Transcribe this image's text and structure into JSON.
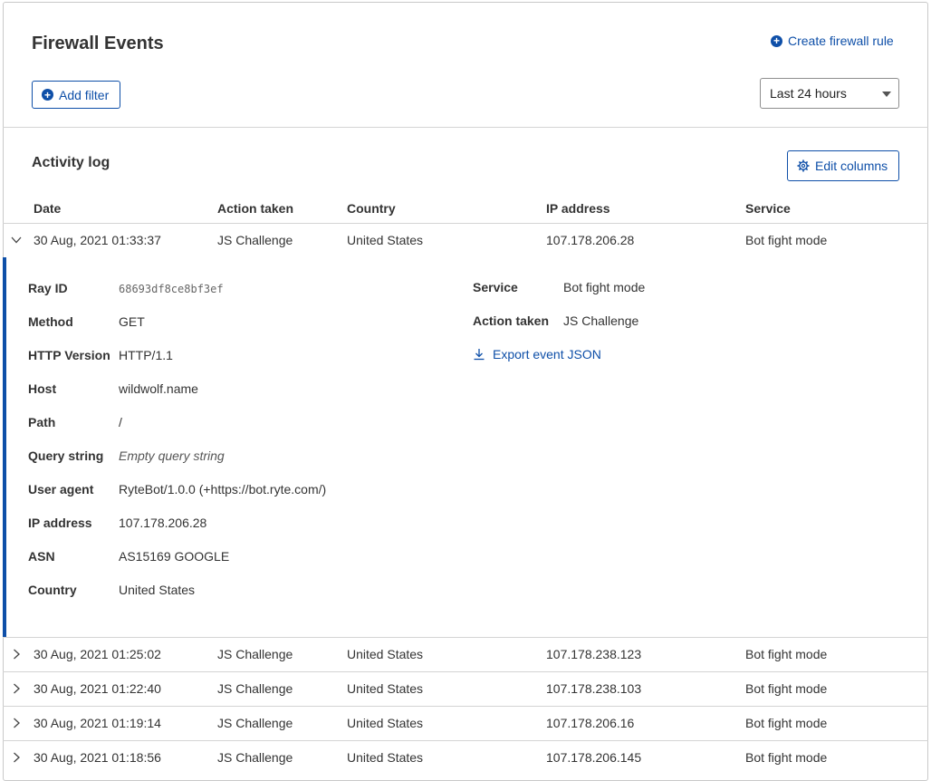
{
  "header": {
    "title": "Firewall Events",
    "create_rule_label": "Create firewall rule",
    "add_filter_label": "Add filter",
    "time_range": "Last 24 hours"
  },
  "activity": {
    "title": "Activity log",
    "edit_columns_label": "Edit columns",
    "columns": [
      "Date",
      "Action taken",
      "Country",
      "IP address",
      "Service"
    ],
    "expanded_row": {
      "date": "30 Aug, 2021 01:33:37",
      "action": "JS Challenge",
      "country": "United States",
      "ip": "107.178.206.28",
      "service": "Bot fight mode"
    },
    "details": {
      "left": [
        {
          "label": "Ray ID",
          "value": "68693df8ce8bf3ef"
        },
        {
          "label": "Method",
          "value": "GET"
        },
        {
          "label": "HTTP Version",
          "value": "HTTP/1.1"
        },
        {
          "label": "Host",
          "value": "wildwolf.name"
        },
        {
          "label": "Path",
          "value": "/"
        },
        {
          "label": "Query string",
          "value": "Empty query string"
        },
        {
          "label": "User agent",
          "value": "RyteBot/1.0.0 (+https://bot.ryte.com/)"
        },
        {
          "label": "IP address",
          "value": "107.178.206.28"
        },
        {
          "label": "ASN",
          "value": "AS15169 GOOGLE"
        },
        {
          "label": "Country",
          "value": "United States"
        }
      ],
      "right": [
        {
          "label": "Service",
          "value": "Bot fight mode"
        },
        {
          "label": "Action taken",
          "value": "JS Challenge"
        }
      ],
      "export_label": "Export event JSON"
    },
    "rows": [
      {
        "date": "30 Aug, 2021 01:25:02",
        "action": "JS Challenge",
        "country": "United States",
        "ip": "107.178.238.123",
        "service": "Bot fight mode"
      },
      {
        "date": "30 Aug, 2021 01:22:40",
        "action": "JS Challenge",
        "country": "United States",
        "ip": "107.178.238.103",
        "service": "Bot fight mode"
      },
      {
        "date": "30 Aug, 2021 01:19:14",
        "action": "JS Challenge",
        "country": "United States",
        "ip": "107.178.206.16",
        "service": "Bot fight mode"
      },
      {
        "date": "30 Aug, 2021 01:18:56",
        "action": "JS Challenge",
        "country": "United States",
        "ip": "107.178.206.145",
        "service": "Bot fight mode"
      }
    ]
  },
  "colors": {
    "accent": "#0e4fa8",
    "border": "#d4d4d4"
  }
}
